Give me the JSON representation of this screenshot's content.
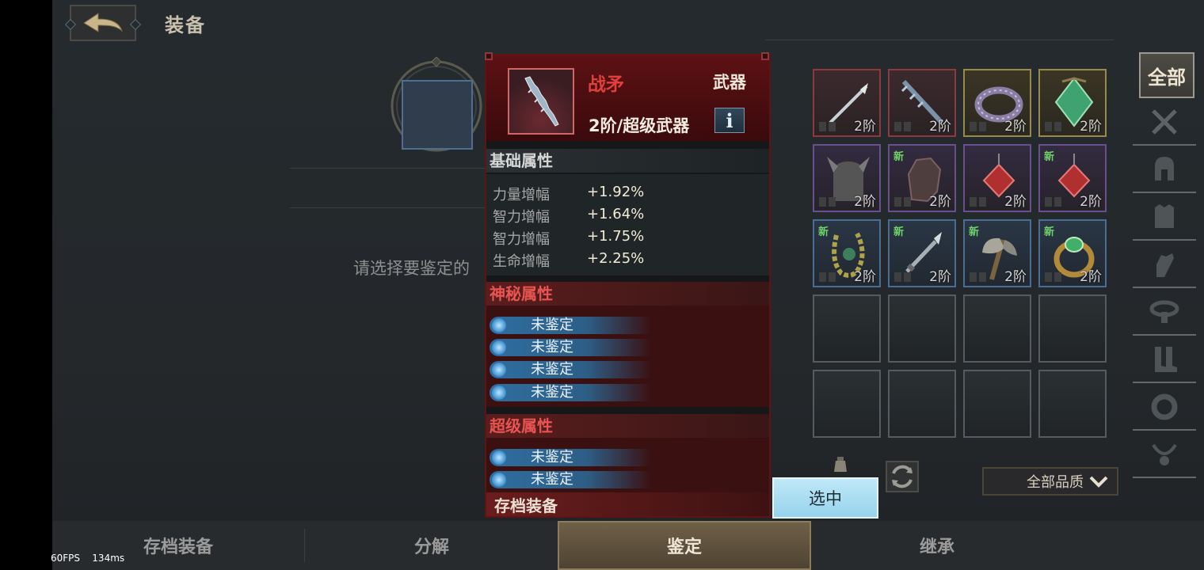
{
  "header": {
    "title": "装备"
  },
  "left_panel": {
    "hint": "请选择要鉴定的"
  },
  "popup": {
    "item_name": "战矛",
    "item_type": "武器",
    "item_tier": "2阶/超级武器",
    "info_label": "i",
    "base_section": {
      "title": "基础属性",
      "stats": [
        {
          "name": "力量增幅",
          "value": "+1.92%"
        },
        {
          "name": "智力增幅",
          "value": "+1.64%"
        },
        {
          "name": "智力增幅",
          "value": "+1.75%"
        },
        {
          "name": "生命增幅",
          "value": "+2.25%"
        }
      ]
    },
    "mystic_section": {
      "title": "神秘属性",
      "lines": [
        "未鉴定",
        "未鉴定",
        "未鉴定",
        "未鉴定"
      ]
    },
    "super_section": {
      "title": "超级属性",
      "lines": [
        "未鉴定",
        "未鉴定"
      ]
    },
    "archive_label": "存档装备"
  },
  "inventory": {
    "items": [
      {
        "rarity": "red",
        "icon": "spear-icon",
        "tier": "2阶",
        "new": ""
      },
      {
        "rarity": "red",
        "icon": "war-spear-icon",
        "tier": "2阶",
        "new": ""
      },
      {
        "rarity": "gold",
        "icon": "ring-icon",
        "tier": "2阶",
        "new": ""
      },
      {
        "rarity": "gold",
        "icon": "green-gem-amulet-icon",
        "tier": "2阶",
        "new": ""
      },
      {
        "rarity": "purple",
        "icon": "horned-helmet-icon",
        "tier": "2阶",
        "new": ""
      },
      {
        "rarity": "purple",
        "icon": "gauntlet-icon",
        "tier": "2阶",
        "new": "新"
      },
      {
        "rarity": "purple",
        "icon": "red-gem-amulet-icon",
        "tier": "2阶",
        "new": ""
      },
      {
        "rarity": "purple",
        "icon": "red-gem-amulet-icon",
        "tier": "2阶",
        "new": "新"
      },
      {
        "rarity": "blue",
        "icon": "chain-necklace-icon",
        "tier": "2阶",
        "new": "新"
      },
      {
        "rarity": "blue",
        "icon": "dagger-icon",
        "tier": "2阶",
        "new": "新"
      },
      {
        "rarity": "blue",
        "icon": "axe-icon",
        "tier": "2阶",
        "new": "新"
      },
      {
        "rarity": "blue",
        "icon": "emerald-ring-icon",
        "tier": "2阶",
        "new": "新"
      }
    ],
    "empty_slots": 8
  },
  "right_tabs": {
    "all_label": "全部",
    "icons": [
      "crossed-swords-icon",
      "helmet-icon",
      "armor-icon",
      "glove-icon",
      "belt-icon",
      "boots-icon",
      "ring-tab-icon",
      "necklace-icon"
    ]
  },
  "controls": {
    "select_label": "选中",
    "quality_label": "全部品质"
  },
  "bottom_nav": {
    "items": [
      "存档装备",
      "分解",
      "鉴定",
      "继承"
    ],
    "active": "鉴定"
  },
  "debug": {
    "fps": "60FPS",
    "latency": "134ms"
  },
  "colors": {
    "accent_red": "#e0403a",
    "select_blue": "#bfe8f8"
  }
}
